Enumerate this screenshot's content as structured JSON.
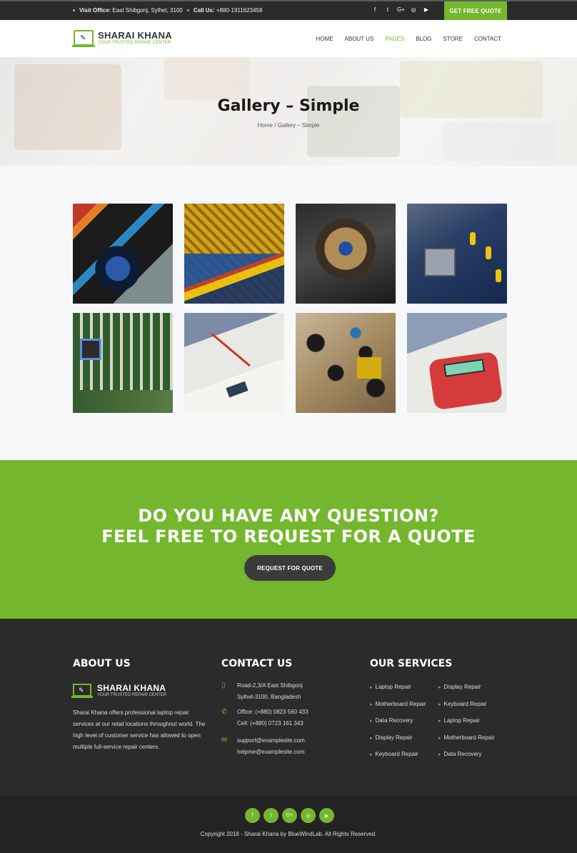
{
  "topbar": {
    "visit_label": "Visit Office:",
    "visit_value": "East Shibgonj, Sylhet, 3100",
    "call_label": "Call Us:",
    "call_value": "+880-1911623458",
    "social": [
      "f",
      "t",
      "G+",
      "◎",
      "▶"
    ],
    "quote_button": "GET FREE QUOTE"
  },
  "brand": {
    "name": "SHARAI KHANA",
    "tagline": "YOUR TRUSTED REPAIR CENTER"
  },
  "nav": {
    "items": [
      "HOME",
      "ABOUT US",
      "PAGES",
      "BLOG",
      "STORE",
      "CONTACT"
    ],
    "active": "PAGES"
  },
  "hero": {
    "title": "Gallery – Simple",
    "breadcrumb": "Home / Gallery – Simple"
  },
  "gallery": {
    "images": [
      "cpu-cooler-cables",
      "motherboard-heatsink",
      "cpu-fan-closeup",
      "miniature-workers-socket",
      "motherboard-ram-slots",
      "soldering-gloves",
      "capacitors-board",
      "multimeter-testing"
    ]
  },
  "cta": {
    "line1": "DO YOU HAVE ANY QUESTION?",
    "line2": "FEEL FREE TO REQUEST FOR A QUOTE",
    "button": "REQUEST FOR QUOTE"
  },
  "footer": {
    "about": {
      "heading": "ABOUT US",
      "text": "Sharai Khana offers professional laptop repair services at our retail locations throughout world. The high level of customer service has allowed to open multiple full-service repair centers."
    },
    "contact": {
      "heading": "CONTACT US",
      "address": [
        "Road-2,3/A East Shibgonj",
        "Sylhet-3100, Bangladesh"
      ],
      "phones": [
        "Office: (+880) 0823 560 433",
        "Cell: (+880) 0723 161 343"
      ],
      "emails": [
        "support@examplesite.com",
        "helpme@examplesite.com"
      ]
    },
    "services": {
      "heading": "OUR SERVICES",
      "items": [
        "Laptop Repair",
        "Display Repair",
        "Motherboard Repair",
        "Keyboard Repair",
        "Data Recovery",
        "Laptop Repair",
        "Display Repair",
        "Motherboard Repair",
        "Keyboard Repair",
        "Data Recovery"
      ]
    },
    "social": [
      "f",
      "t",
      "G+",
      "◎",
      "▶"
    ],
    "copyright": "Copyright 2018 - Sharai Khana by BlueWindLab. All Rights Reserved."
  },
  "colors": {
    "accent": "#74b72e",
    "dark": "#2b2b2b",
    "button_dark": "#3b3b3b"
  }
}
